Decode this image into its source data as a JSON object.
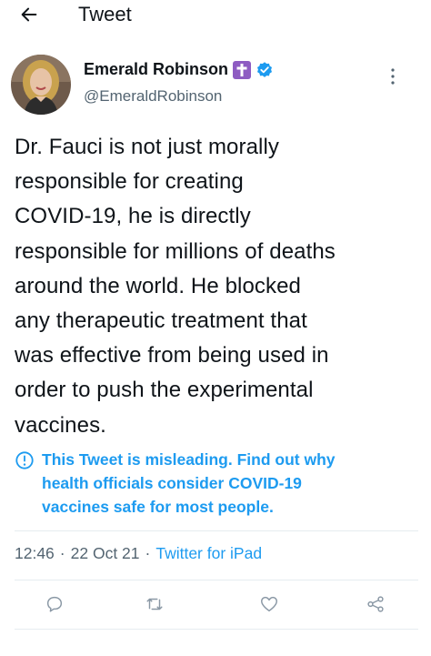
{
  "header": {
    "back_icon": "arrow-left-icon",
    "title": "Tweet"
  },
  "author": {
    "name": "Emerald Robinson",
    "handle": "@EmeraldRobinson",
    "badge_icon": "latin-cross-icon",
    "verified_icon": "verified-check-icon",
    "badge_color": "#8e5cc2",
    "verified_color": "#1d9bf0"
  },
  "tweet": {
    "text": "Dr. Fauci is not just morally\nresponsible for creating\nCOVID-19, he is directly\nresponsible for millions of deaths\naround the world. He blocked\nany therapeutic treatment that\nwas effective from being used in\norder to push the experimental\nvaccines."
  },
  "notice": {
    "icon": "info-circle-icon",
    "text": "This Tweet is misleading. Find out why\nhealth officials consider COVID-19\nvaccines safe for most people.",
    "color": "#1d9bf0"
  },
  "meta": {
    "time": "12:46",
    "sep1": "·",
    "date": "22 Oct 21",
    "sep2": "·",
    "source": "Twitter for iPad"
  },
  "actions": [
    "reply-icon",
    "retweet-icon",
    "like-icon",
    "share-icon"
  ]
}
